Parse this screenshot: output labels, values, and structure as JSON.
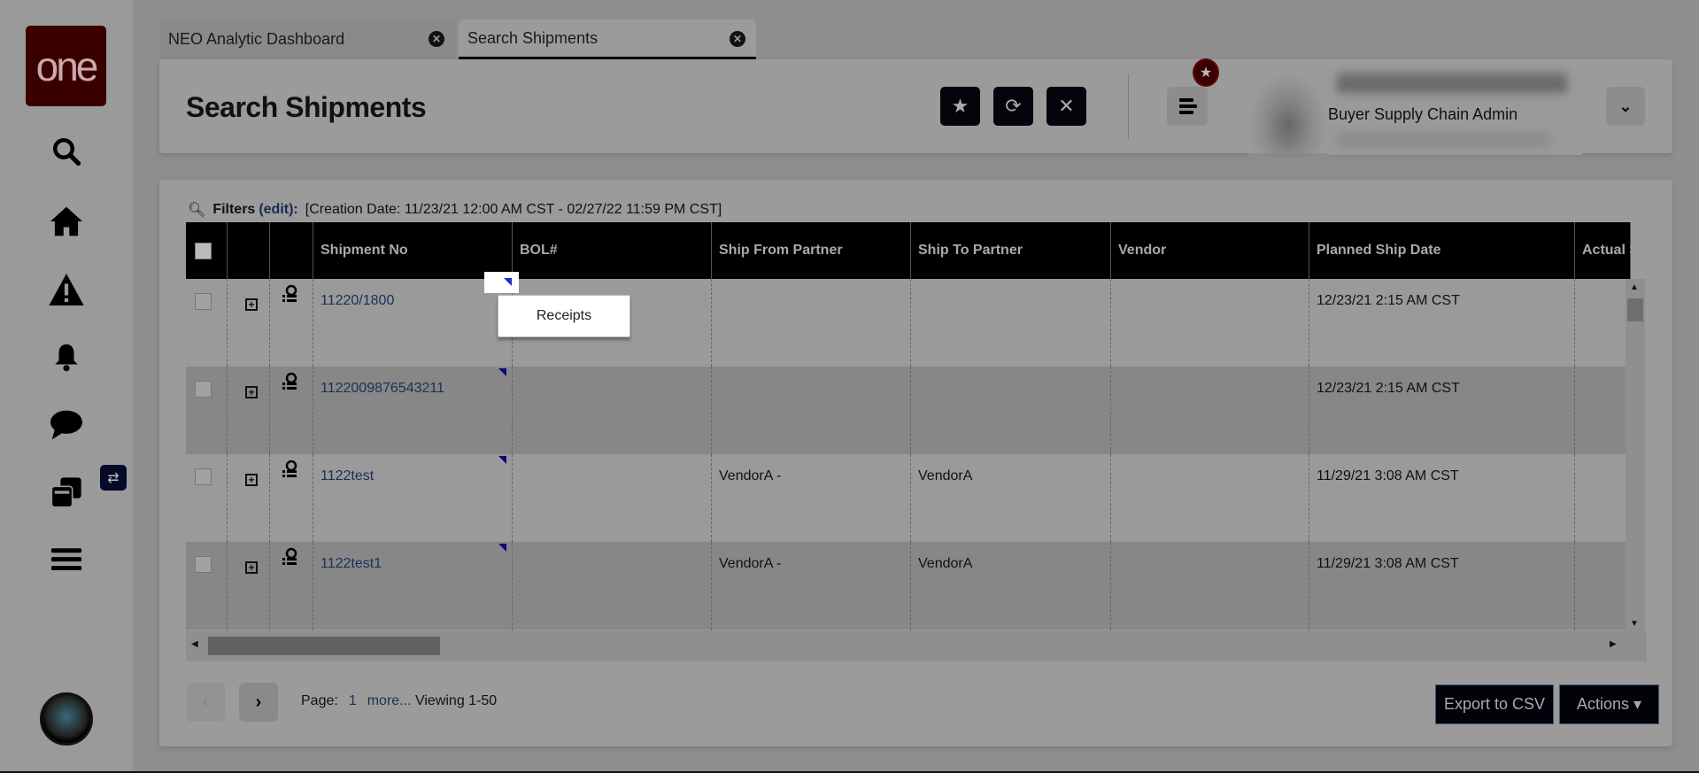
{
  "sidebar": {
    "logo_text": "one",
    "items": [
      "search",
      "home",
      "alerts",
      "notifications",
      "messages",
      "windows",
      "menu"
    ],
    "swap_icon": "⇄"
  },
  "tabs": [
    {
      "label": "NEO Analytic Dashboard",
      "active": false
    },
    {
      "label": "Search Shipments",
      "active": true
    }
  ],
  "header": {
    "title": "Search Shipments",
    "user_role": "Buyer Supply Chain Admin"
  },
  "filters": {
    "label": "Filters",
    "edit": "(edit):",
    "value": "[Creation Date: 11/23/21 12:00 AM CST - 02/27/22 11:59 PM CST]"
  },
  "table": {
    "columns": [
      "",
      "",
      "",
      "Shipment No",
      "BOL#",
      "Ship From Partner",
      "Ship To Partner",
      "Vendor",
      "Planned Ship Date",
      "Actual Sh"
    ],
    "rows": [
      {
        "shipment_no": "11220/1800",
        "bol": "",
        "from": "",
        "to": "",
        "vendor": "",
        "planned": "12/23/21 2:15 AM CST"
      },
      {
        "shipment_no": "1122009876543211",
        "bol": "",
        "from": "",
        "to": "",
        "vendor": "",
        "planned": "12/23/21 2:15 AM CST"
      },
      {
        "shipment_no": "1122test",
        "bol": "",
        "from": "VendorA -",
        "to": "VendorA",
        "vendor": "",
        "planned": "11/29/21 3:08 AM CST"
      },
      {
        "shipment_no": "1122test1",
        "bol": "",
        "from": "VendorA -",
        "to": "VendorA",
        "vendor": "",
        "planned": "11/29/21 3:08 AM CST"
      },
      {
        "shipment_no": "",
        "bol": "",
        "from": "",
        "to": "",
        "vendor": "",
        "planned": ""
      }
    ]
  },
  "popup": {
    "item": "Receipts"
  },
  "pagination": {
    "page_label": "Page:",
    "page": "1",
    "more": "more...",
    "viewing": "Viewing 1-50"
  },
  "buttons": {
    "export": "Export to CSV",
    "actions": "Actions ▾"
  }
}
